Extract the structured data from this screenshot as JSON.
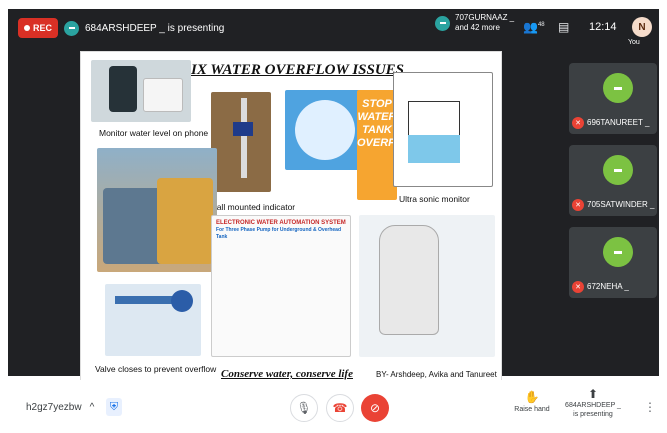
{
  "topbar": {
    "rec_label": "REC",
    "presenter_text": "684ARSHDEEP _ is presenting",
    "participants_line1": "707GURNAAZ _",
    "participants_line2": "and 42 more",
    "people_count": "48",
    "time": "12:14",
    "avatar_letter": "N",
    "you_label": "You"
  },
  "slide": {
    "title": "FIX WATER OVERFLOW ISSUES",
    "captions": {
      "phone": "Monitor water level on phone",
      "wall": "Wall mounted indicator",
      "ultrasonic": "Ultra sonic monitor",
      "valve": "Valve closes to prevent overflow"
    },
    "ad_text": "STOP WATER TANK OVERFLOW",
    "automation": {
      "header": "ELECTRONIC WATER AUTOMATION SYSTEM",
      "sub": "For Three Phase Pump for Underground & Overhead Tank"
    },
    "conserve": "Conserve water, conserve life",
    "byline": "BY- Arshdeep, Avika and Tanureet"
  },
  "tiles": [
    {
      "name": "696TANUREET _"
    },
    {
      "name": "705SATWINDER _"
    },
    {
      "name": "672NEHA _"
    }
  ],
  "bottombar": {
    "meeting_code": "h2gz7yezbw",
    "raise_hand": "Raise hand",
    "presenter_line1": "684ARSHDEEP _",
    "presenter_line2": "is presenting"
  },
  "colors": {
    "rec": "#d93025",
    "end_call": "#ea4335",
    "tile_avatar": "#7cc242"
  }
}
